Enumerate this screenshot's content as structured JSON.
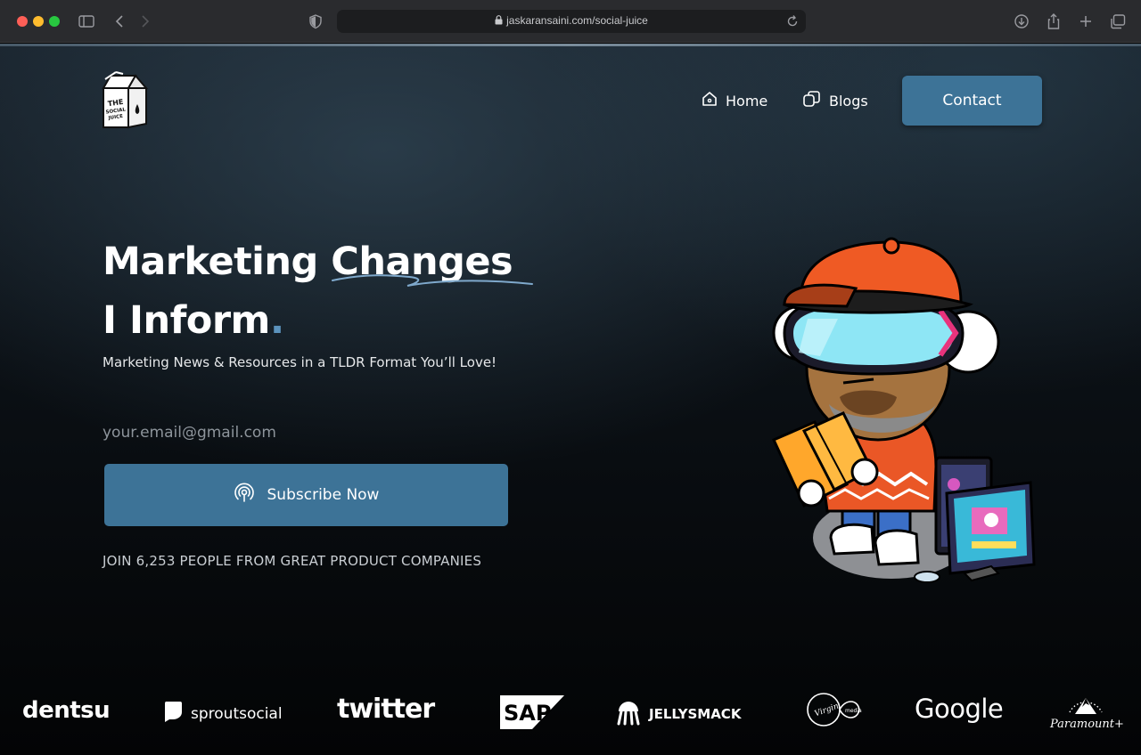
{
  "browser": {
    "url": "jaskaransaini.com/social-juice"
  },
  "nav": {
    "logo_text": "THE SOCIAL JUICE",
    "home_label": "Home",
    "blogs_label": "Blogs",
    "contact_label": "Contact"
  },
  "hero": {
    "title_part1": "Marketing ",
    "title_highlight": "Changes",
    "title_line2": "I Inform",
    "title_dot": ".",
    "subtitle": "Marketing News & Resources in a TLDR Format You’ll Love!",
    "email_placeholder": "your.email@gmail.com",
    "subscribe_label": "Subscribe Now",
    "join_text": "JOIN 6,253 PEOPLE FROM GREAT PRODUCT COMPANIES"
  },
  "brands": {
    "dentsu": "dentsu",
    "sprout": "sproutsocial",
    "twitter": "twitter",
    "sap": "SAP",
    "jellysmack": "JELLYSMACK",
    "virgin": "Virgin media",
    "google": "Google",
    "paramount": "Paramount+"
  },
  "colors": {
    "accent": "#3d7397",
    "dot": "#5c93bd",
    "background": "#0b1015"
  },
  "icons": [
    "sidebar-icon",
    "back-icon",
    "forward-icon",
    "shield-icon",
    "lock-icon",
    "reload-icon",
    "download-icon",
    "share-icon",
    "new-tab-icon",
    "tabs-icon",
    "home-icon",
    "blogs-icon",
    "podcast-icon"
  ]
}
